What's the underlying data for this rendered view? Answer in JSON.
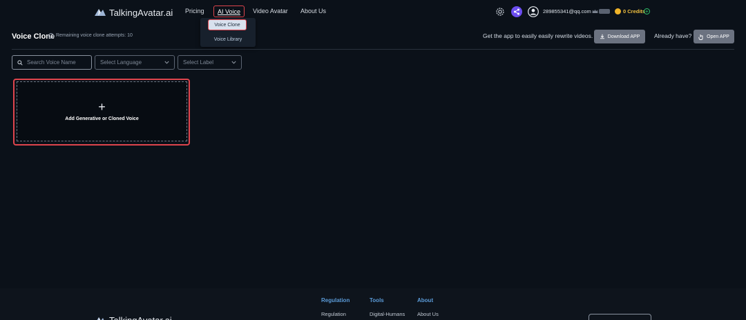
{
  "brand": {
    "name": "TalkingAvatar.ai"
  },
  "nav": {
    "pricing": "Pricing",
    "ai_voice": "AI Voice",
    "video_avatar": "Video Avatar",
    "about_us": "About Us"
  },
  "dropdown": {
    "voice_clone": "Voice Clone",
    "voice_library": "Voice Library"
  },
  "account": {
    "email": "289855341@qq.com",
    "credits": "0 Credits",
    "vip_icon": "crown-icon"
  },
  "header": {
    "title": "Voice Clone",
    "attempts": "Remaining voice clone attempts: 10",
    "get_app_text": "Get the app to easily easily rewrite videos.",
    "download_label": "Download APP",
    "already_text": "Already have?",
    "open_label": "Open APP"
  },
  "filters": {
    "search_placeholder": "Search Voice Name",
    "language_placeholder": "Select Language",
    "label_placeholder": "Select Label"
  },
  "card": {
    "plus": "+",
    "text": "Add Generative or Cloned Voice"
  },
  "footer": {
    "columns": [
      {
        "title": "Regulation",
        "link": "Regulation"
      },
      {
        "title": "Tools",
        "link": "Digital-Humans"
      },
      {
        "title": "About",
        "link": "About Us"
      }
    ]
  },
  "colors": {
    "background": "#0b1119",
    "highlight": "#e0454d",
    "accent": "#6c4ef0",
    "credits": "#f0c040",
    "link": "#5b9bd8"
  }
}
